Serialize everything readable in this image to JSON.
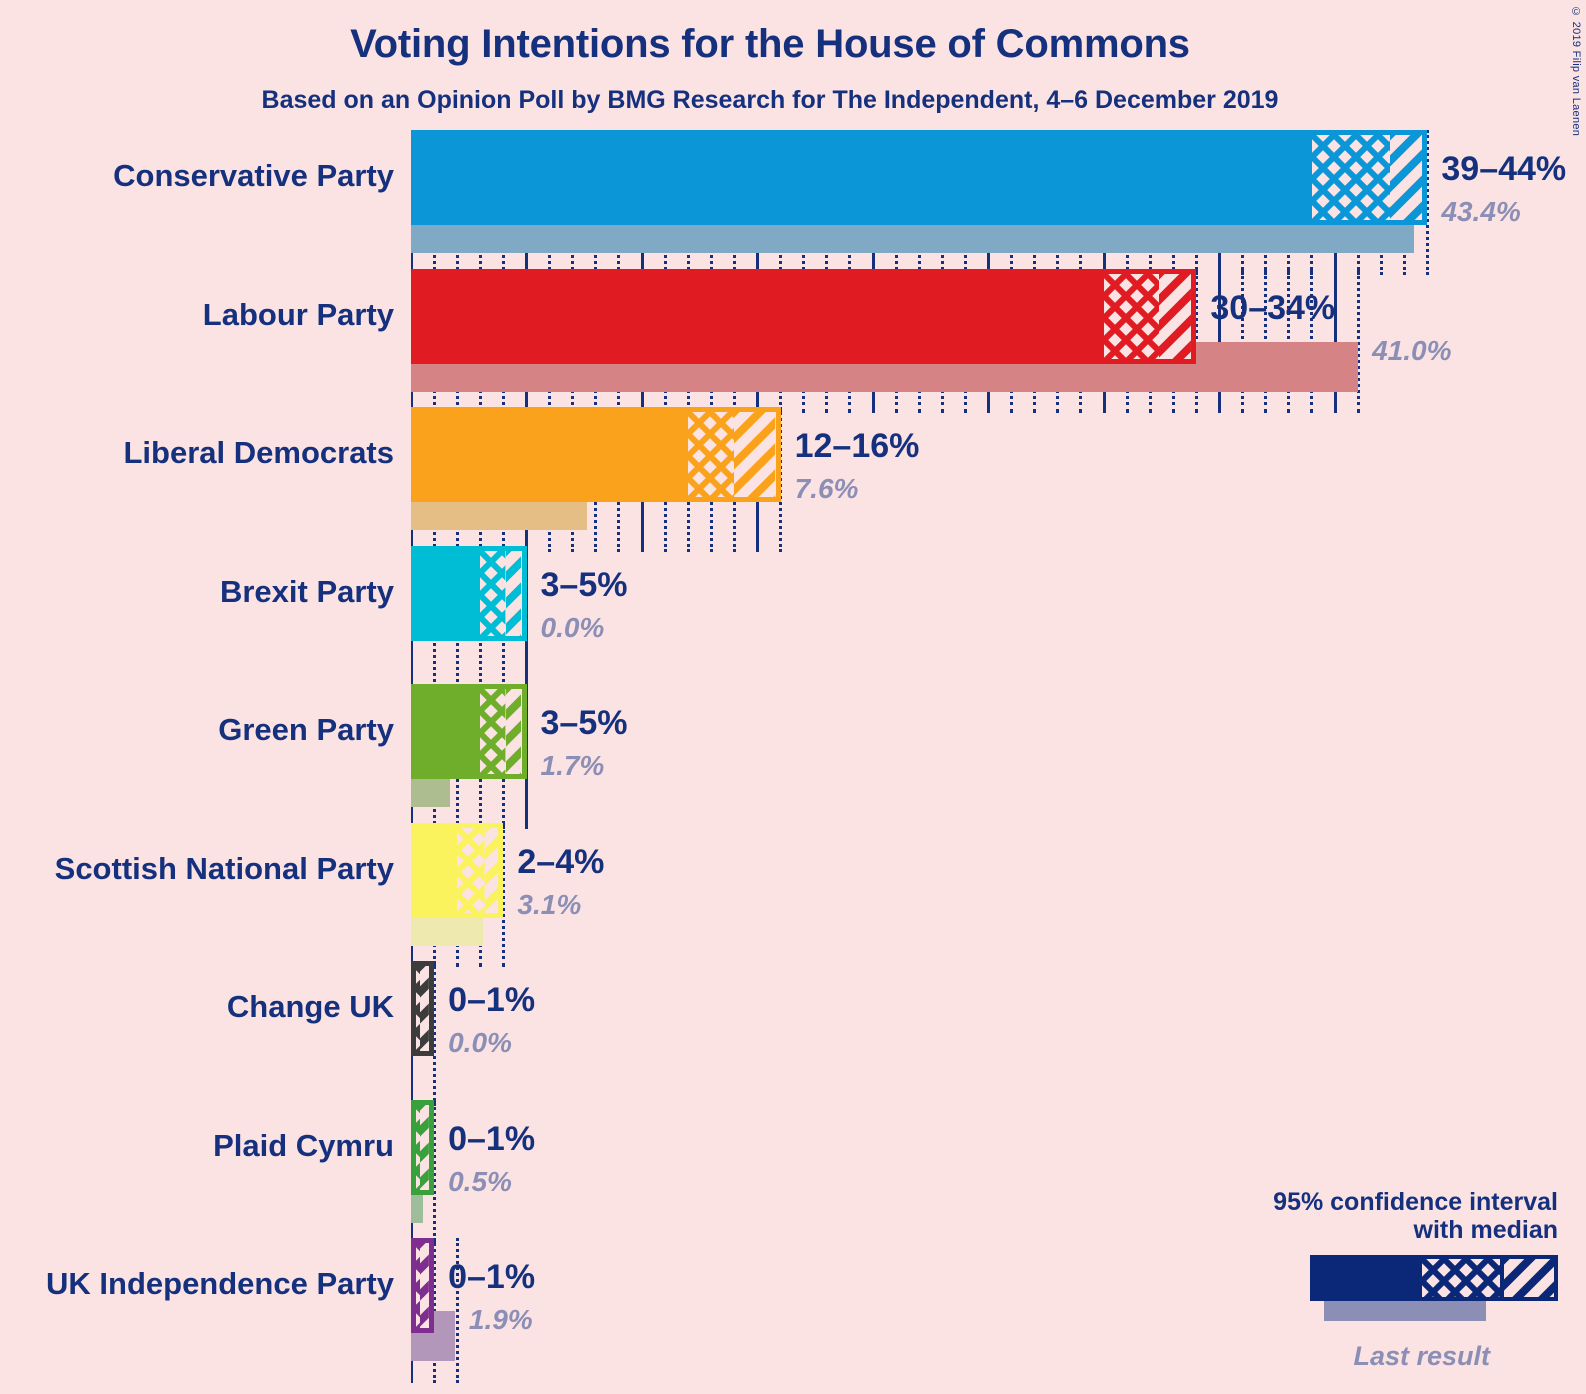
{
  "header": {
    "title": "Voting Intentions for the House of Commons",
    "subtitle": "Based on an Opinion Poll by BMG Research for The Independent, 4–6 December 2019",
    "copyright": "© 2019 Filip van Laenen"
  },
  "legend": {
    "line1": "95% confidence interval",
    "line2": "with median",
    "last_result_label": "Last result"
  },
  "colors": {
    "background": "#FBE2E3",
    "text": "#15317E",
    "last_result_text": "#8C8FB5",
    "legend_bar": "#0B2878"
  },
  "chart_data": {
    "type": "bar",
    "title": "Voting Intentions for the House of Commons",
    "subtitle": "Based on an Opinion Poll by BMG Research for The Independent, 4–6 December 2019",
    "xlabel": "",
    "ylabel": "",
    "xlim": [
      0,
      50
    ],
    "grid": true,
    "grid_major_step": 5,
    "grid_minor_step": 1,
    "legend_position": "bottom-right",
    "categories": [
      "Conservative Party",
      "Labour Party",
      "Liberal Democrats",
      "Brexit Party",
      "Green Party",
      "Scottish National Party",
      "Change UK",
      "Plaid Cymru",
      "UK Independence Party"
    ],
    "series": [
      {
        "name": "95% confidence interval with median",
        "type": "interval",
        "values": [
          {
            "low": 39,
            "high": 44,
            "median": 42.4
          },
          {
            "low": 30,
            "high": 34,
            "median": 32.4
          },
          {
            "low": 12,
            "high": 16,
            "median": 14.0
          },
          {
            "low": 3,
            "high": 5,
            "median": 4.1
          },
          {
            "low": 3,
            "high": 5,
            "median": 4.1
          },
          {
            "low": 2,
            "high": 4,
            "median": 3.2
          },
          {
            "low": 0,
            "high": 1,
            "median": 0.4
          },
          {
            "low": 0,
            "high": 1,
            "median": 0.4
          },
          {
            "low": 0,
            "high": 1,
            "median": 0.4
          }
        ]
      },
      {
        "name": "Last result",
        "type": "bar",
        "values": [
          43.4,
          41.0,
          7.6,
          0.0,
          1.7,
          3.1,
          0.0,
          0.5,
          1.9
        ]
      }
    ],
    "range_labels": [
      "39–44%",
      "30–34%",
      "12–16%",
      "3–5%",
      "3–5%",
      "2–4%",
      "0–1%",
      "0–1%",
      "0–1%"
    ],
    "last_result_labels": [
      "43.4%",
      "41.0%",
      "7.6%",
      "0.0%",
      "1.7%",
      "3.1%",
      "0.0%",
      "0.5%",
      "1.9%"
    ],
    "party_colors": [
      "#0B96D8",
      "#E01B22",
      "#FAA21B",
      "#00BDD6",
      "#6FAE2B",
      "#FAF35E",
      "#3C3C3C",
      "#39A13B",
      "#7E2E8E"
    ],
    "last_result_colors": [
      "#7FA9C4",
      "#D68385",
      "#E5BE86",
      "#C9C4C1",
      "#ADBD8F",
      "#EEE9AE",
      "#B4ADA9",
      "#9EBD9A",
      "#B397BB"
    ]
  },
  "rows": [
    {
      "label": "Conservative Party",
      "range": "39–44%",
      "last": "43.4%",
      "low": 39,
      "high": 44,
      "median": 42.4,
      "last_value": 43.4,
      "color": "#0B96D8",
      "last_color": "#7FA9C4"
    },
    {
      "label": "Labour Party",
      "range": "30–34%",
      "last": "41.0%",
      "low": 30,
      "high": 34,
      "median": 32.4,
      "last_value": 41.0,
      "color": "#E01B22",
      "last_color": "#D68385"
    },
    {
      "label": "Liberal Democrats",
      "range": "12–16%",
      "last": "7.6%",
      "low": 12,
      "high": 16,
      "median": 14.0,
      "last_value": 7.6,
      "color": "#FAA21B",
      "last_color": "#E5BE86"
    },
    {
      "label": "Brexit Party",
      "range": "3–5%",
      "last": "0.0%",
      "low": 3,
      "high": 5,
      "median": 4.1,
      "last_value": 0.0,
      "color": "#00BDD6",
      "last_color": "#C9C4C1"
    },
    {
      "label": "Green Party",
      "range": "3–5%",
      "last": "1.7%",
      "low": 3,
      "high": 5,
      "median": 4.1,
      "last_value": 1.7,
      "color": "#6FAE2B",
      "last_color": "#ADBD8F"
    },
    {
      "label": "Scottish National Party",
      "range": "2–4%",
      "last": "3.1%",
      "low": 2,
      "high": 4,
      "median": 3.2,
      "last_value": 3.1,
      "color": "#FAF35E",
      "last_color": "#EEE9AE"
    },
    {
      "label": "Change UK",
      "range": "0–1%",
      "last": "0.0%",
      "low": 0,
      "high": 1,
      "median": 0.4,
      "last_value": 0.0,
      "color": "#3C3C3C",
      "last_color": "#B4ADA9"
    },
    {
      "label": "Plaid Cymru",
      "range": "0–1%",
      "last": "0.5%",
      "low": 0,
      "high": 1,
      "median": 0.4,
      "last_value": 0.5,
      "color": "#39A13B",
      "last_color": "#9EBD9A"
    },
    {
      "label": "UK Independence Party",
      "range": "0–1%",
      "last": "1.9%",
      "low": 0,
      "high": 1,
      "median": 0.4,
      "last_value": 1.9,
      "color": "#7E2E8E",
      "last_color": "#B397BB"
    }
  ]
}
